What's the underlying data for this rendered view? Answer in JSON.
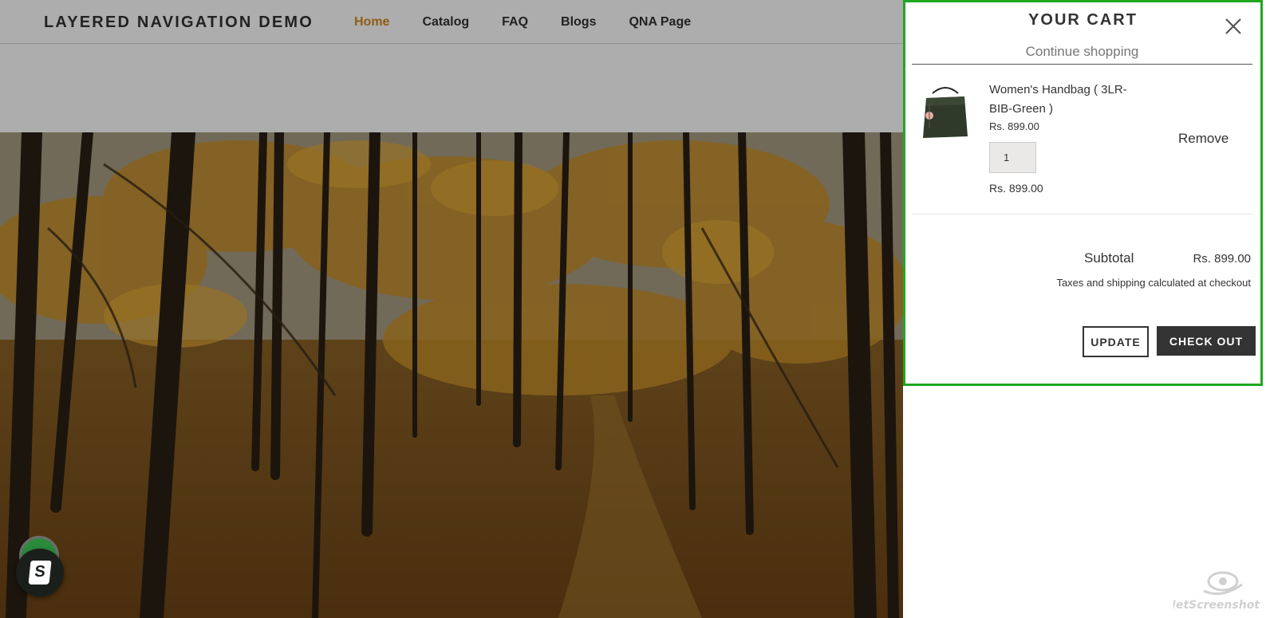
{
  "header": {
    "logo": "LAYERED NAVIGATION DEMO",
    "nav": [
      {
        "label": "Home",
        "active": true
      },
      {
        "label": "Catalog",
        "active": false
      },
      {
        "label": "FAQ",
        "active": false
      },
      {
        "label": "Blogs",
        "active": false
      },
      {
        "label": "QNA Page",
        "active": false
      }
    ]
  },
  "cart": {
    "title": "YOUR CART",
    "continue_label": "Continue shopping",
    "item": {
      "name": "Women's Handbag ( 3LR-BIB-Green )",
      "price": "Rs. 899.00",
      "quantity": "1",
      "line_total": "Rs. 899.00",
      "remove_label": "Remove"
    },
    "subtotal_label": "Subtotal",
    "subtotal_value": "Rs. 899.00",
    "tax_note": "Taxes and shipping calculated at checkout",
    "update_label": "UPDATE",
    "checkout_label": "CHECK OUT"
  },
  "colors": {
    "accent": "#d68a1e",
    "highlight_border": "#1fa81f",
    "checkout_bg": "#333333"
  },
  "watermark": "JetScreenshot"
}
